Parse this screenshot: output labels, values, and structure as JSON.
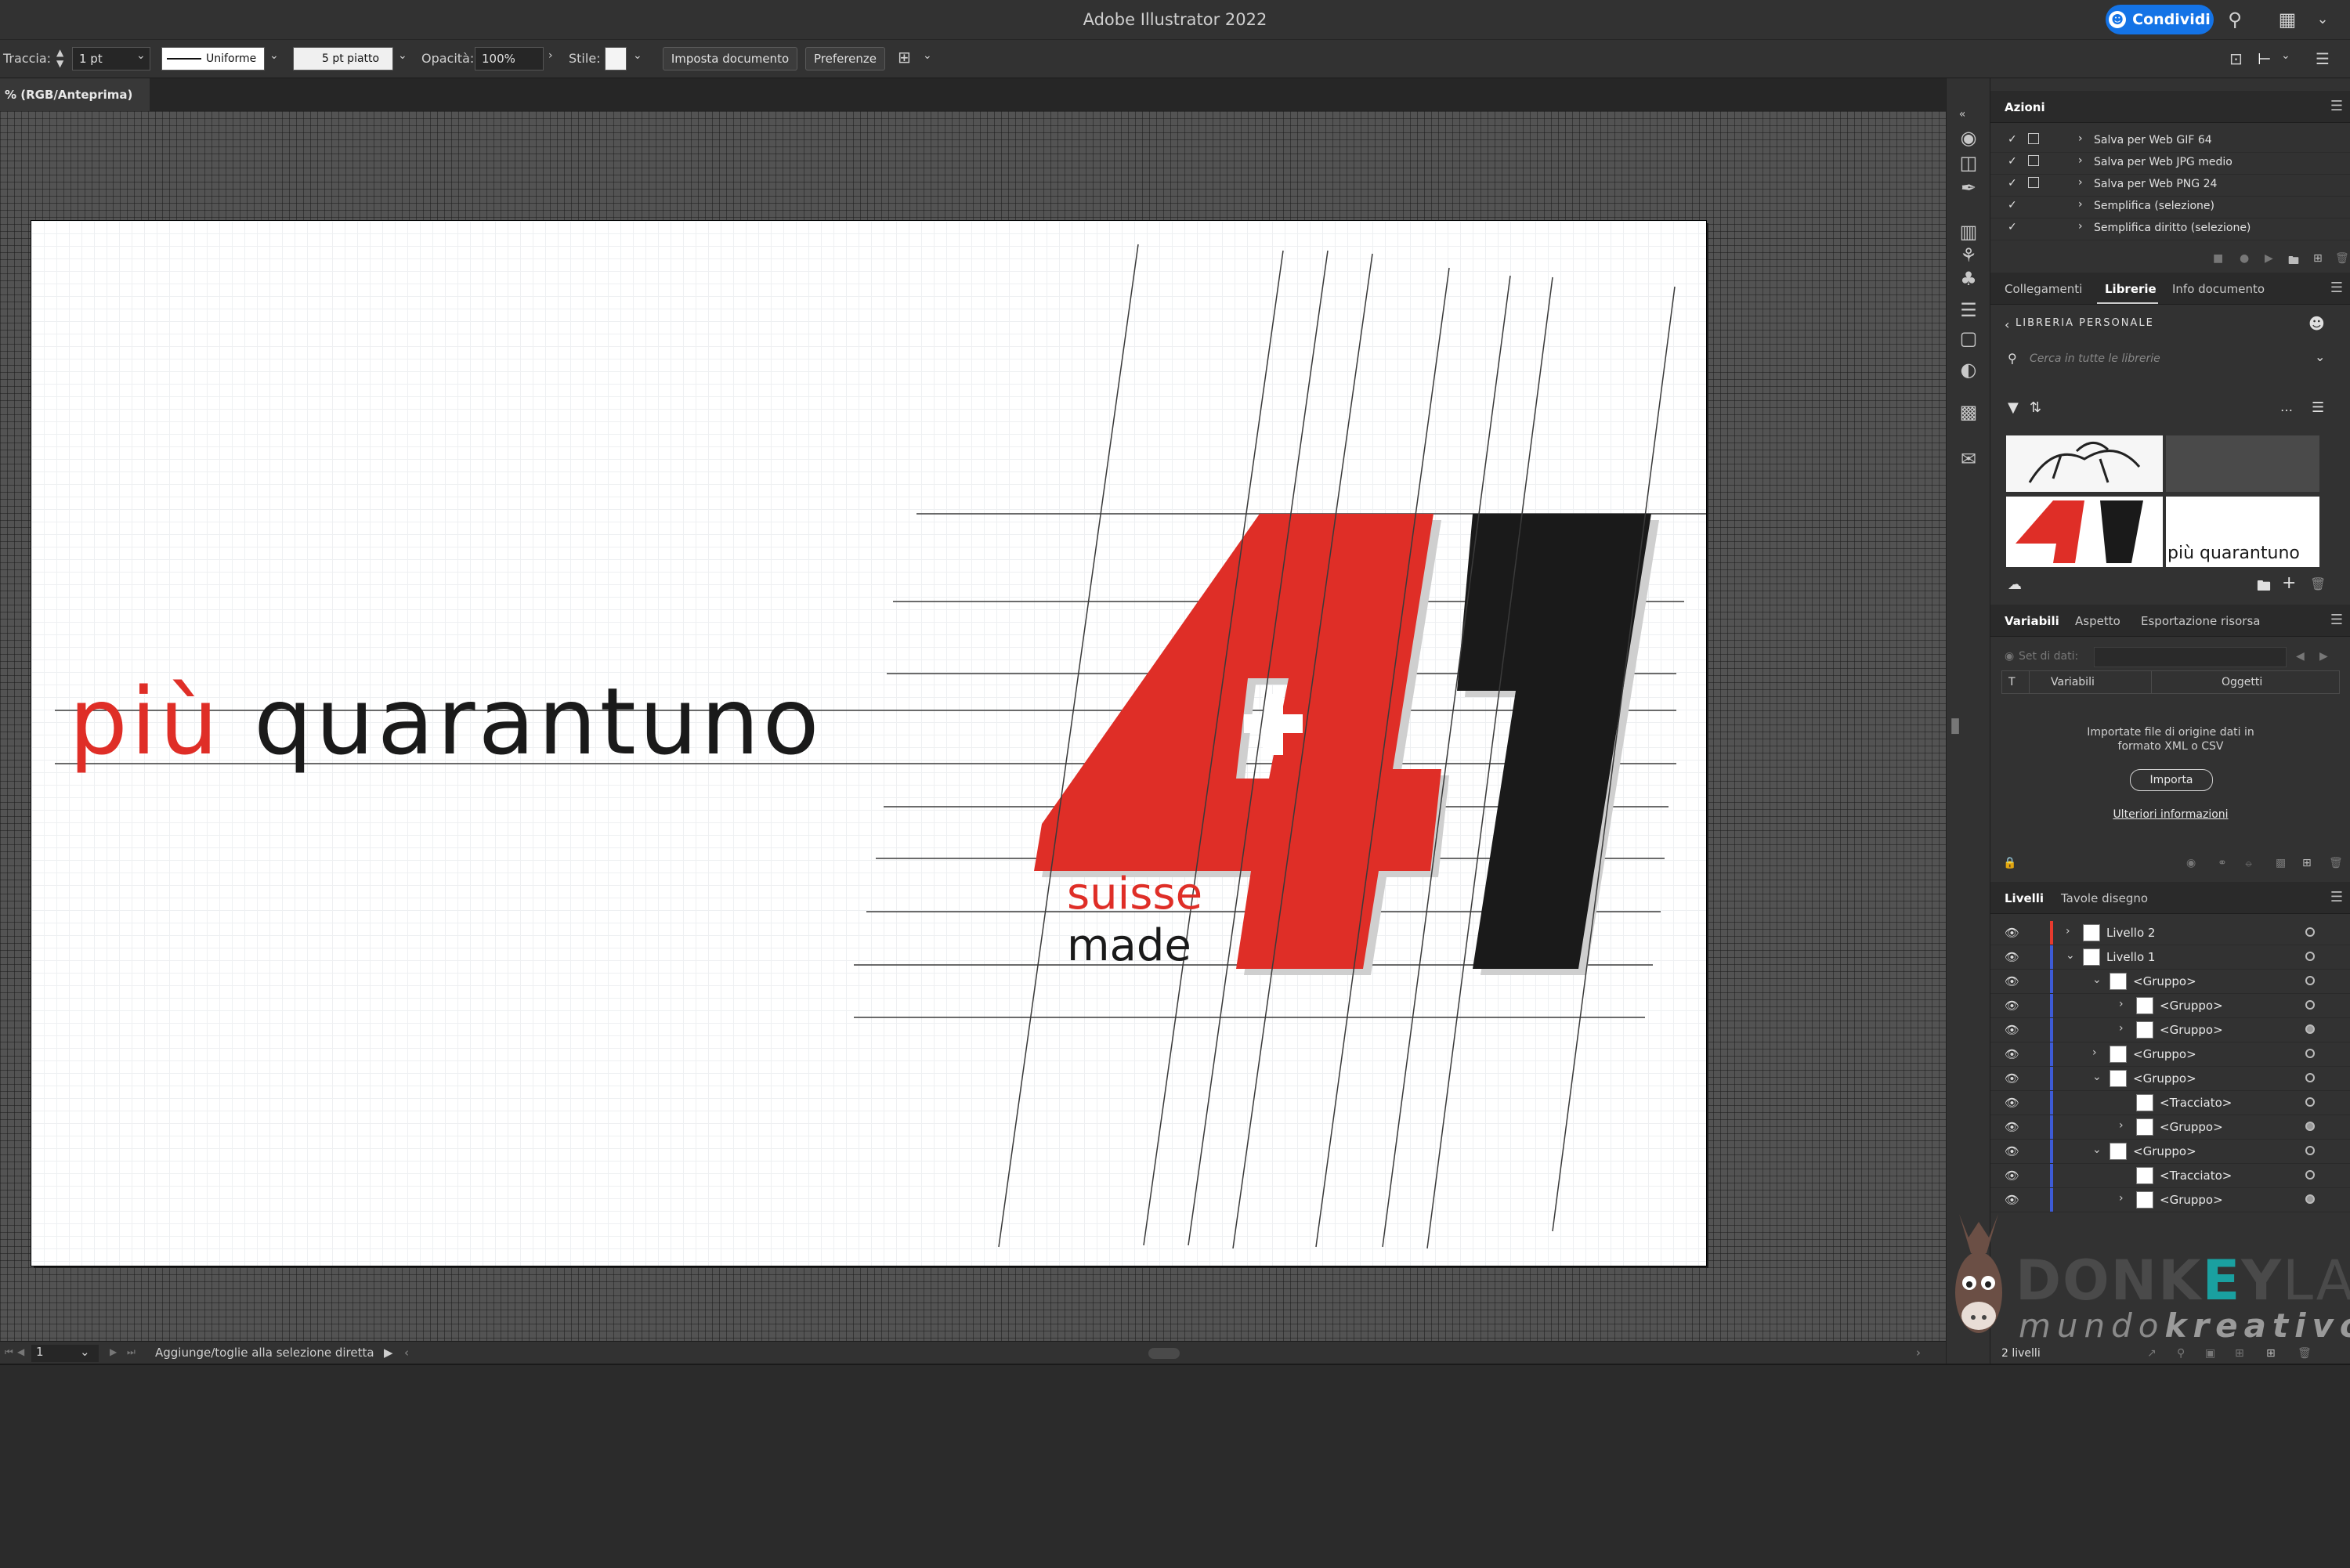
{
  "app": {
    "title": "Adobe Illustrator 2022",
    "share_label": "Condividi"
  },
  "control_bar": {
    "stroke_label": "Traccia:",
    "stroke_weight": "1 pt",
    "profile": "Uniforme",
    "brush": "5 pt piatto",
    "opacity_label": "Opacità:",
    "opacity_value": "100%",
    "style_label": "Stile:",
    "document_setup": "Imposta documento",
    "preferences": "Preferenze"
  },
  "document_tab": "% (RGB/Anteprima)",
  "artwork": {
    "word_red": "più",
    "word_black": "quarantuno",
    "suisse": "suisse",
    "made": "made",
    "colors": {
      "red": "#df2e27",
      "black": "#1a1a1a"
    }
  },
  "actions_panel": {
    "title": "Azioni",
    "items": [
      "Salva per Web GIF 64",
      "Salva per Web JPG medio",
      "Salva per Web PNG 24",
      "Semplifica (selezione)",
      "Semplifica diritto (selezione)"
    ]
  },
  "libraries_panel": {
    "tabs": [
      "Collegamenti",
      "Librerie",
      "Info documento"
    ],
    "active_tab": "Librerie",
    "library_name": "LIBRERIA PERSONALE",
    "search_placeholder": "Cerca in tutte le librerie",
    "thumb_text": "più quarantuno"
  },
  "variables_panel": {
    "tabs": [
      "Variabili",
      "Aspetto",
      "Esportazione risorsa"
    ],
    "dataset_label": "Set di dati:",
    "col_t": "T",
    "col_variables": "Variabili",
    "col_objects": "Oggetti",
    "import_msg_1": "Importate file di origine dati in",
    "import_msg_2": "formato XML o CSV",
    "import_button": "Importa",
    "more_info": "Ulteriori informazioni"
  },
  "layers_panel": {
    "tabs": [
      "Livelli",
      "Tavole disegno"
    ],
    "rows": [
      {
        "name": "Livello 2",
        "indent": 0,
        "chev": "›",
        "bar": "#e63a2e"
      },
      {
        "name": "Livello 1",
        "indent": 0,
        "chev": "⌄",
        "bar": "#3d5bd6"
      },
      {
        "name": "<Gruppo>",
        "indent": 1,
        "chev": "⌄",
        "bar": "#3d5bd6"
      },
      {
        "name": "<Gruppo>",
        "indent": 2,
        "chev": "›",
        "bar": "#3d5bd6"
      },
      {
        "name": "<Gruppo>",
        "indent": 2,
        "chev": "›",
        "bar": "#3d5bd6"
      },
      {
        "name": "<Gruppo>",
        "indent": 1,
        "chev": "›",
        "bar": "#3d5bd6"
      },
      {
        "name": "<Gruppo>",
        "indent": 1,
        "chev": "⌄",
        "bar": "#3d5bd6"
      },
      {
        "name": "<Tracciato>",
        "indent": 2,
        "chev": "",
        "bar": "#3d5bd6"
      },
      {
        "name": "<Gruppo>",
        "indent": 2,
        "chev": "›",
        "bar": "#3d5bd6"
      },
      {
        "name": "<Gruppo>",
        "indent": 1,
        "chev": "⌄",
        "bar": "#3d5bd6"
      },
      {
        "name": "<Tracciato>",
        "indent": 2,
        "chev": "",
        "bar": "#3d5bd6"
      },
      {
        "name": "<Gruppo>",
        "indent": 2,
        "chev": "›",
        "bar": "#3d5bd6"
      }
    ],
    "count": "2 livelli"
  },
  "watermark": {
    "brand_a": "DONK",
    "brand_b": "E",
    "brand_c": "Y",
    "brand_d": "LAB",
    "tagline_a": "mundo",
    "tagline_b": "kreativo"
  },
  "status_bar": {
    "artboard": "1",
    "message": "Aggiunge/toglie alla selezione diretta"
  }
}
